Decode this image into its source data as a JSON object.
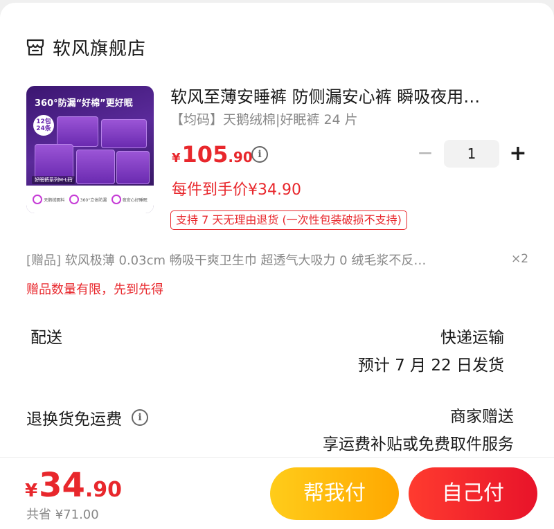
{
  "store": {
    "name": "软风旗舰店",
    "icon": "store-icon"
  },
  "product": {
    "thumbnail": {
      "headline": "360°防漏“好棉”更好眠",
      "badge": "12包 24条",
      "series": "好眠裤系列M-L码",
      "features": [
        "天鹅绒面料",
        "360°立体防漏",
        "夜安心好睡眠"
      ]
    },
    "title": "软风至薄安睡裤 防侧漏安心裤 瞬吸夜用…",
    "spec": "【均码】天鹅绒棉|好眠裤 24 片",
    "price": {
      "currency": "¥",
      "integer": "105",
      "decimal": ".90"
    },
    "quantity": "1",
    "stepper": {
      "minus": "−",
      "plus": "+"
    },
    "unit_price": "每件到手价¥34.90",
    "return_tag": "支持 7 天无理由退货 (一次性包装破损不支持)"
  },
  "gift": {
    "text": "[赠品] 软风极薄 0.03cm 畅吸干爽卫生巾 超透气大吸力 0 绒毛浆不反…",
    "qty": "×2",
    "note": "赠品数量有限，先到先得"
  },
  "shipping": {
    "label": "配送",
    "method": "快递运输",
    "date": "预计 7 月 22 日发货"
  },
  "returns": {
    "label": "退换货免运费",
    "gift": "商家赠送",
    "service": "享运费补贴或免费取件服务"
  },
  "footer": {
    "total": {
      "currency": "¥",
      "integer": "34",
      "decimal": ".90"
    },
    "saved": "共省 ¥71.00",
    "help_pay": "帮我付",
    "self_pay": "自己付"
  },
  "colors": {
    "accent": "#e8272c",
    "help_button": "#ffb800",
    "pay_button": "#f0192c"
  }
}
